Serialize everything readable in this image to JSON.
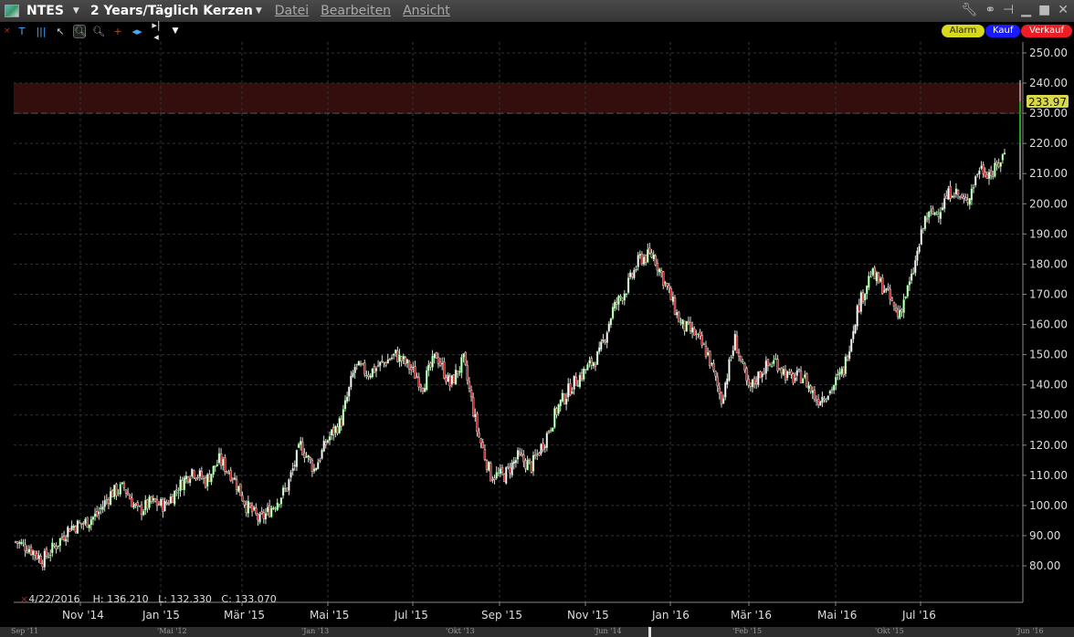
{
  "title": {
    "symbol": "NTES",
    "period": "2 Years/Täglich Kerzen"
  },
  "menu": [
    "Datei",
    "Bearbeiten",
    "Ansicht"
  ],
  "buttons": {
    "alarm": "Alarm",
    "buy": "Kauf",
    "sell": "Verkauf"
  },
  "colors": {
    "alarm": "#d8d81c",
    "buy": "#1a1aff",
    "sell": "#ee1c24",
    "up": "#1fa81f",
    "down": "#c02020",
    "band": "#3a0e0e",
    "price_tag": "#d8d84a"
  },
  "info": {
    "date": "4/22/2016",
    "high": "H: 136.210",
    "low": "L: 132.330",
    "close": "C: 133.070"
  },
  "last_price": "233.97",
  "scroller_labels": [
    "Sep '11",
    "'Mai '12",
    "'Jan '13",
    "'Okt '13",
    "'Jun '14",
    "'Feb '15",
    "'Okt '15",
    "'Jun '16"
  ],
  "chart_data": {
    "type": "candlestick",
    "title": "NTES 2 Years/Täglich Kerzen",
    "x_ticks": [
      "Nov '14",
      "Jan '15",
      "Mär '15",
      "Mai '15",
      "Jul '15",
      "Sep '15",
      "Nov '15",
      "Jan '16",
      "Mär '16",
      "Mai '16",
      "Jul '16"
    ],
    "y_ticks": [
      "80.00",
      "90.00",
      "100.00",
      "110.00",
      "120.00",
      "130.00",
      "140.00",
      "150.00",
      "160.00",
      "170.00",
      "180.00",
      "190.00",
      "200.00",
      "210.00",
      "220.00",
      "230.00",
      "240.00",
      "250.00"
    ],
    "ylim": [
      76,
      254
    ],
    "highlight_band": [
      230,
      240
    ],
    "approx_closes": [
      88,
      86,
      82,
      87,
      93,
      94,
      97,
      104,
      106,
      98,
      101,
      100,
      106,
      112,
      108,
      115,
      110,
      100,
      95,
      100,
      106,
      120,
      112,
      122,
      128,
      146,
      144,
      147,
      150,
      146,
      140,
      150,
      140,
      148,
      125,
      110,
      110,
      116,
      113,
      122,
      133,
      140,
      145,
      150,
      165,
      172,
      182,
      183,
      172,
      160,
      157,
      150,
      135,
      155,
      138,
      145,
      148,
      142,
      143,
      135,
      138,
      145,
      165,
      177,
      172,
      163,
      175,
      195,
      198,
      205,
      200,
      212,
      210,
      218,
      234
    ],
    "last": {
      "close": 233.97,
      "high": 241,
      "low": 208
    }
  }
}
